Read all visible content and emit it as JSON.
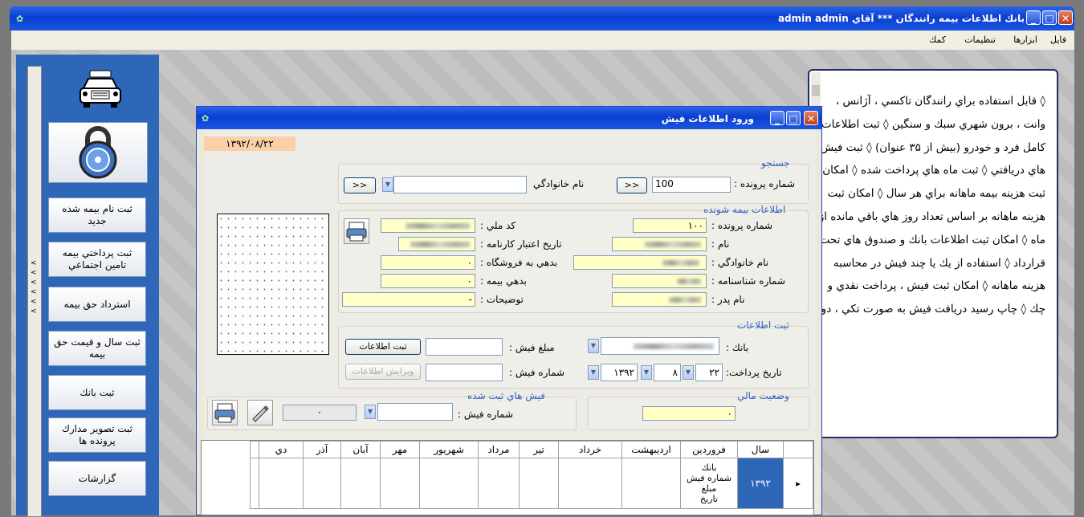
{
  "window": {
    "title": "بانك اطلاعات بيمه رانندگان *** آقاي  admin admin",
    "controls": {
      "minimize": "_",
      "maximize": "□",
      "close": "✕"
    }
  },
  "menu": [
    "فايل",
    "ابزارها",
    "تنظيمات",
    "كمك"
  ],
  "sidebar": {
    "buttons": [
      "ثبت نام بيمه شده جديد",
      "ثبت پرداختي بيمه تامين اجتماعي",
      "استرداد حق بيمه",
      "ثبت سال و قيمت حق بيمه",
      "ثبت بانك",
      "ثبت تصوير مدارك پرونده ها",
      "گزارشات"
    ],
    "strip_chevrons": [
      "<",
      "<",
      "<",
      "<",
      "<",
      "<"
    ]
  },
  "info_panel": {
    "text": "◊ قابل استفاده براي رانندگان تاكسي ، آژانس ، وانت ، برون شهري سبك و سنگين ◊ ثبت اطلاعات كامل فرد و خودرو (بيش از ۳۵ عنوان) ◊ ثبت فيش هاي دريافتي ◊ ثبت ماه هاي پرداخت شده ◊ امكان ثبت هزينه بيمه ماهانه براي هر سال ◊ امكان ثبت هزينه ماهانه بر اساس تعداد روز هاي باقي مانده از ماه ◊ امكان ثبت اطلاعات بانك و صندوق هاي تحت قرارداد ◊ استفاده از يك يا چند فيش در محاسبه هزينه ماهانه ◊ امكان ثبت فيش ، پرداخت نقدي و چك ◊ چاپ رسيد دريافت فيش به صورت تكي ، دو"
  },
  "dialog": {
    "title": "ورود اطلاعات فيش",
    "date": "۱۳۹۲/۰۸/۲۲",
    "search": {
      "legend": "جستجو",
      "file_number_label": "شماره پرونده :",
      "file_number_value": "100",
      "last_name_label": "نام خانوادگي",
      "go_button": "<<"
    },
    "insured": {
      "legend": "اطلاعات بيمه شونده",
      "file_number_label": "شماره پرونده :",
      "file_number_value": "۱۰۰",
      "name_label": "نام :",
      "last_name_label": "نام خانوادگي :",
      "id_number_label": "شماره شناسنامه :",
      "father_name_label": "نام پدر :",
      "national_code_label": "كد ملي :",
      "card_validity_label": "تاريخ اعتبار كارنامه :",
      "store_debt_label": "بدهي به فروشگاه :",
      "store_debt_value": "۰",
      "insurance_debt_label": "بدهي بيمه :",
      "insurance_debt_value": "۰",
      "description_label": "توضيحات :",
      "description_value": "-"
    },
    "register": {
      "legend": "ثبت اطلاعات",
      "bank_label": "بانك :",
      "amount_label": "مبلغ فيش :",
      "save_button": "ثبت اطلاعات",
      "pay_date_label": "تاريخ پرداخت:",
      "day": "۲۲",
      "month": "۸",
      "year": "۱۳۹۲",
      "receipt_number_label": "شماره فيش :",
      "edit_button": "ويرايش اطلاعات"
    },
    "financial": {
      "legend": "وضعيت مالي",
      "value": "۰"
    },
    "receipts": {
      "legend": "فيش هاي ثبت شده",
      "receipt_number_label": "شماره فيش :",
      "count_value": "۰"
    }
  },
  "grid": {
    "headers": [
      "سال",
      "فروردين",
      "ارديبهشت",
      "خرداد",
      "تير",
      "مرداد",
      "شهريور",
      "مهر",
      "آبان",
      "آذر",
      "دي"
    ],
    "row": {
      "year": "۱۳۹۲",
      "labels": [
        "بانك",
        "شماره فيش",
        "مبلغ",
        "تاريخ"
      ],
      "indicator": "▸"
    }
  },
  "colors": {
    "titlebar": "#0a3fd0",
    "panel": "#2e66b8",
    "field_yellow": "#ffffc6",
    "date_orange": "#fbd0a8"
  }
}
